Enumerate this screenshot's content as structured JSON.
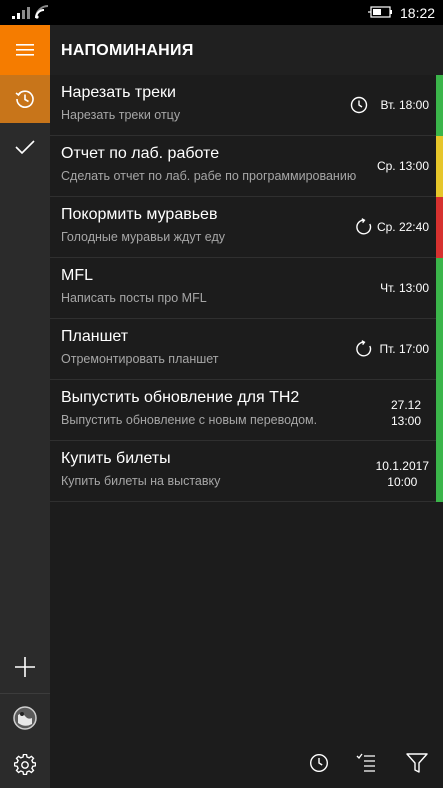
{
  "status_bar": {
    "time": "18:22"
  },
  "header": {
    "title": "НАПОМИНАНИЯ"
  },
  "colors": {
    "accent": "#f57c00",
    "accent_selected": "#c8751a",
    "green": "#3bb54a",
    "yellow": "#e6c62a",
    "red": "#d6312f"
  },
  "reminders": [
    {
      "title": "Нарезать треки",
      "subtitle": "Нарезать треки отцу",
      "date": "Вт. 18:00",
      "icon": "clock-icon",
      "color": "#3bb54a"
    },
    {
      "title": "Отчет по лаб. работе",
      "subtitle": "Сделать отчет по лаб. рабе по программированию",
      "date": "Ср. 13:00",
      "icon": "",
      "color": "#e6c62a"
    },
    {
      "title": "Покормить муравьев",
      "subtitle": "Голодные муравьи ждут еду",
      "date": "Ср. 22:40",
      "icon": "repeat-icon",
      "color": "#d6312f"
    },
    {
      "title": "MFL",
      "subtitle": "Написать посты про MFL",
      "date": "Чт. 13:00",
      "icon": "",
      "color": "#3bb54a"
    },
    {
      "title": "Планшет",
      "subtitle": "Отремонтировать планшет",
      "date": "Пт. 17:00",
      "icon": "repeat-icon",
      "color": "#3bb54a"
    },
    {
      "title": "Выпустить обновление для TH2",
      "subtitle": "Выпустить обновление с новым переводом.",
      "date_line1": "27.12",
      "date_line2": "13:00",
      "icon": "",
      "color": "#3bb54a"
    },
    {
      "title": "Купить билеты",
      "subtitle": "Купить билеты на выставку",
      "date_line1": "10.1.2017",
      "date_line2": "10:00",
      "icon": "",
      "color": "#3bb54a"
    }
  ],
  "sidebar": {
    "icons": [
      "hamburger-icon",
      "history-icon",
      "checkmark-icon",
      "plus-icon",
      "avatar",
      "gear-icon"
    ]
  },
  "appbar": {
    "icons": [
      "alarm-icon",
      "checklist-icon",
      "filter-icon"
    ]
  }
}
